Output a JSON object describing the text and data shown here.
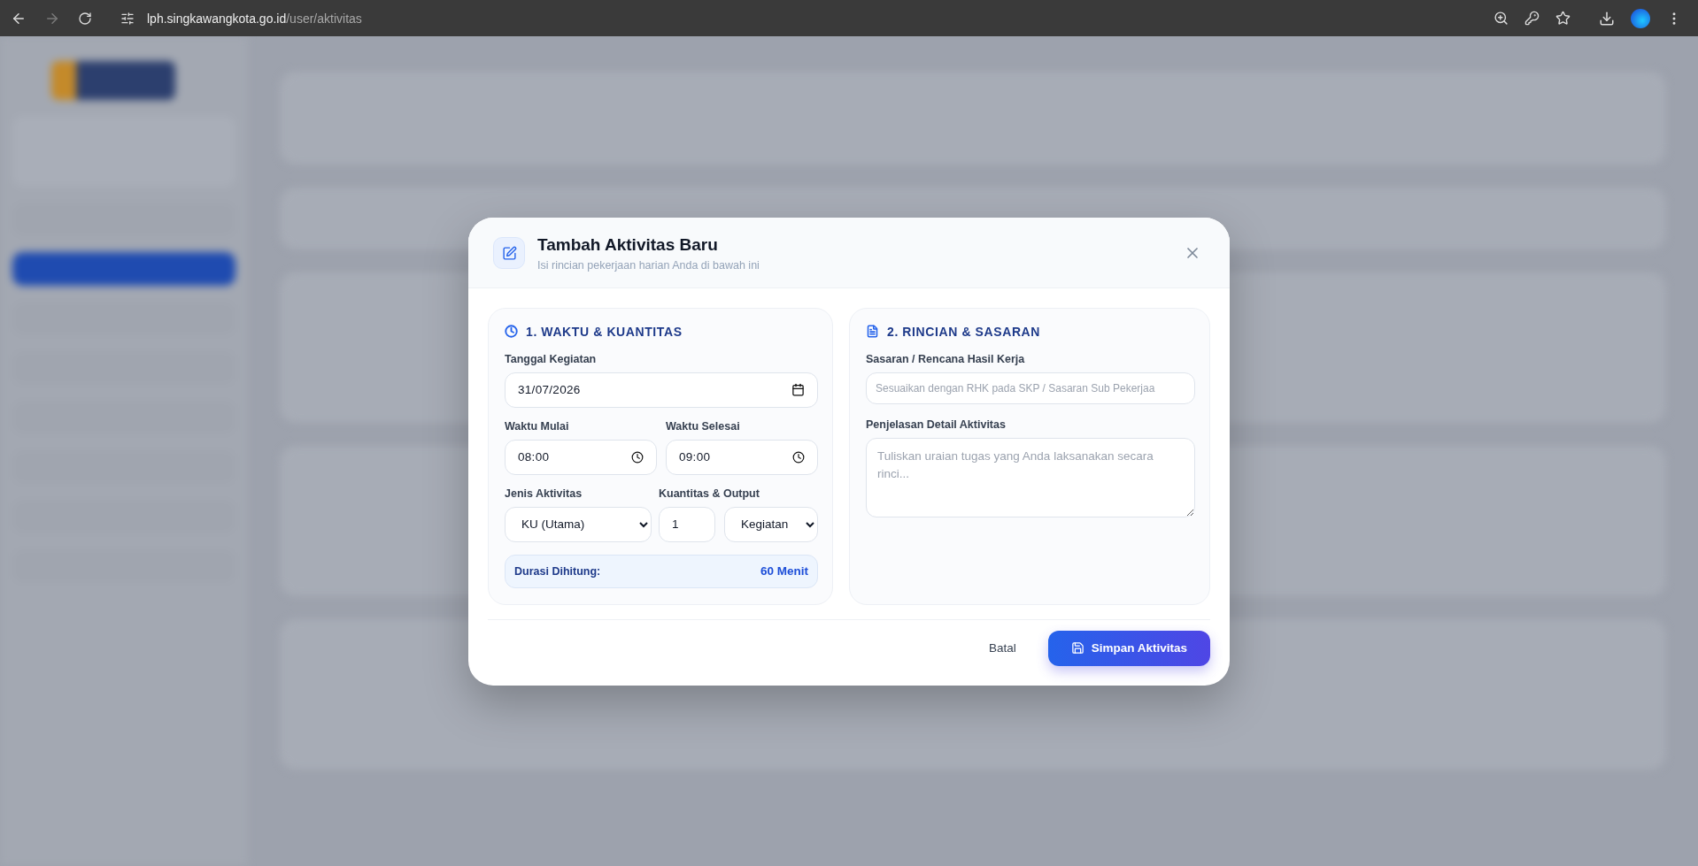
{
  "browser": {
    "url_host": "lph.singkawangkota.go.id",
    "url_path": "/user/aktivitas"
  },
  "modal": {
    "title": "Tambah Aktivitas Baru",
    "subtitle": "Isi rincian pekerjaan harian Anda di bawah ini",
    "time_section": {
      "title": "1. WAKTU & KUANTITAS",
      "date": {
        "label": "Tanggal Kegiatan",
        "value": "31/07/2026"
      },
      "start": {
        "label": "Waktu Mulai",
        "value": "08:00"
      },
      "end": {
        "label": "Waktu Selesai",
        "value": "09:00"
      },
      "type": {
        "label": "Jenis Aktivitas",
        "value": "KU (Utama)"
      },
      "quantity": {
        "label": "Kuantitas & Output",
        "value": "1",
        "unit": "Kegiatan"
      },
      "duration": {
        "label": "Durasi Dihitung:",
        "value": "60 Menit"
      }
    },
    "detail_section": {
      "title": "2. RINCIAN & SASARAN",
      "target": {
        "label": "Sasaran / Rencana Hasil Kerja",
        "placeholder": "Sesuaikan dengan RHK pada SKP / Sasaran Sub Pekerjaa"
      },
      "description": {
        "label": "Penjelasan Detail Aktivitas",
        "placeholder": "Tuliskan uraian tugas yang Anda laksanakan secara rinci..."
      }
    },
    "buttons": {
      "cancel": "Batal",
      "save": "Simpan Aktivitas"
    }
  }
}
